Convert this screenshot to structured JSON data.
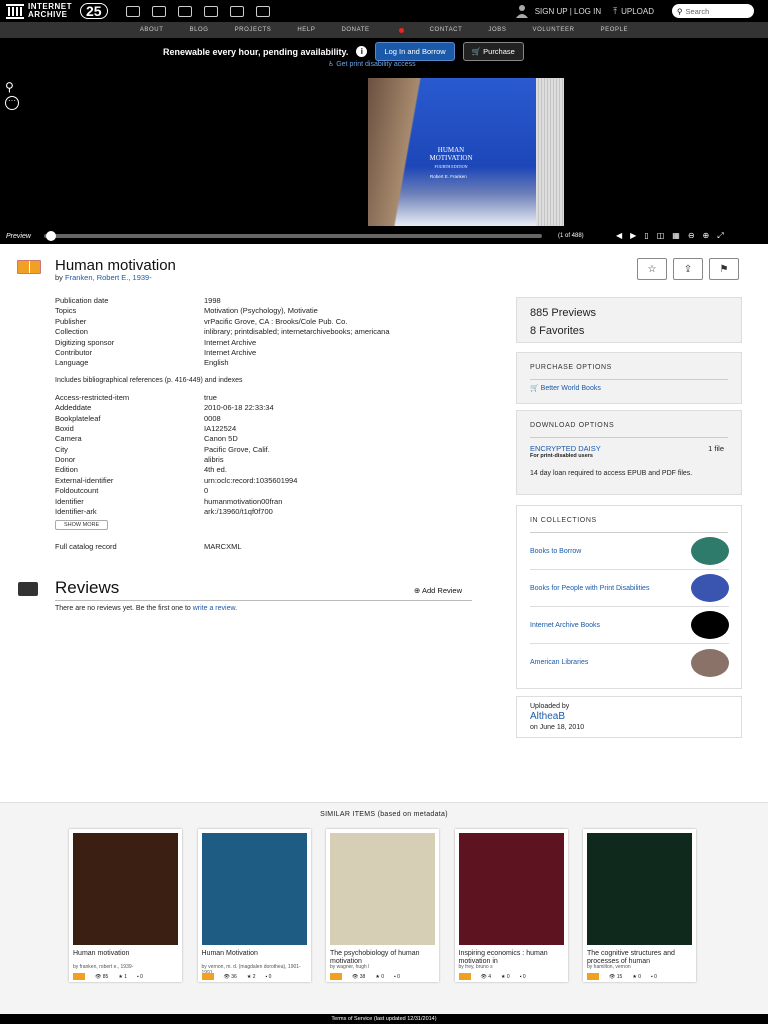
{
  "header": {
    "logo_line1": "INTERNET",
    "logo_line2": "ARCHIVE",
    "anniversary": "25",
    "signup": "SIGN UP | LOG IN",
    "upload": "UPLOAD",
    "search_placeholder": "Search"
  },
  "nav": [
    "ABOUT",
    "BLOG",
    "PROJECTS",
    "HELP",
    "DONATE",
    "CONTACT",
    "JOBS",
    "VOLUNTEER",
    "PEOPLE"
  ],
  "banner": {
    "message": "Renewable every hour, pending availability.",
    "borrow": "Log In and Borrow",
    "purchase": "Purchase",
    "print_link": "Get print disability access"
  },
  "viewer": {
    "mode_label": "Preview",
    "page_count": "(1 of 488)",
    "cover_title": "HUMAN MOTIVATION",
    "cover_edition": "FOURTH EDITION",
    "cover_author": "Robert E. Franken"
  },
  "item": {
    "title": "Human motivation",
    "by": "by",
    "author": "Franken, Robert E., 1939-"
  },
  "meta_top": [
    {
      "k": "Publication date",
      "v": "1998",
      "link": true
    },
    {
      "k": "Topics",
      "v": "Motivation (Psychology), Motivatie",
      "link": true
    },
    {
      "k": "Publisher",
      "v": "vrPacific Grove, CA : Brooks/Cole Pub. Co.",
      "link": false
    },
    {
      "k": "Collection",
      "v": "inlibrary; printdisabled; internetarchivebooks; americana",
      "link": true
    },
    {
      "k": "Digitizing sponsor",
      "v": "Internet Archive",
      "link": true
    },
    {
      "k": "Contributor",
      "v": "Internet Archive",
      "link": true
    },
    {
      "k": "Language",
      "v": "English",
      "link": true
    }
  ],
  "note": "Includes bibliographical references (p. 416-449) and indexes",
  "meta_bottom": [
    {
      "k": "Access-restricted-item",
      "v": "true",
      "link": false
    },
    {
      "k": "Addeddate",
      "v": "2010-06-18 22:33:34",
      "link": false
    },
    {
      "k": "Bookplateleaf",
      "v": "0008",
      "link": false
    },
    {
      "k": "Boxid",
      "v": "IA122524",
      "link": false
    },
    {
      "k": "Camera",
      "v": "Canon 5D",
      "link": false
    },
    {
      "k": "City",
      "v": "Pacific Grove, Calif.",
      "link": false
    },
    {
      "k": "Donor",
      "v": "alibris",
      "link": true
    },
    {
      "k": "Edition",
      "v": "4th ed.",
      "link": false
    },
    {
      "k": "External-identifier",
      "v": "urn:oclc:record:1035601994",
      "link": true
    },
    {
      "k": "Foldoutcount",
      "v": "0",
      "link": false
    },
    {
      "k": "Identifier",
      "v": "humanmotivation00fran",
      "link": false
    },
    {
      "k": "Identifier-ark",
      "v": "ark:/13960/t1qf0f700",
      "link": false
    }
  ],
  "show_more": "SHOW MORE",
  "catalog": {
    "k": "Full catalog record",
    "v": "MARCXML"
  },
  "reviews": {
    "title": "Reviews",
    "add": "Add Review",
    "none_text": "There are no reviews yet. Be the first one to",
    "none_link": "write a review",
    "none_end": "."
  },
  "stats": {
    "previews": "885 Previews",
    "favorites": "8 Favorites"
  },
  "purchase": {
    "heading": "PURCHASE OPTIONS",
    "bw": "Better World Books"
  },
  "download": {
    "heading": "DOWNLOAD OPTIONS",
    "daisy": "ENCRYPTED DAISY",
    "files": "1 file",
    "sub": "For print-disabled users",
    "loan": "14 day loan required to access EPUB and PDF files."
  },
  "collections": {
    "heading": "IN COLLECTIONS",
    "items": [
      {
        "name": "Books to Borrow",
        "color": "#2e7a6b"
      },
      {
        "name": "Books for People with Print Disabilities",
        "color": "#3a55b0"
      },
      {
        "name": "Internet Archive Books",
        "color": "#000000"
      },
      {
        "name": "American Libraries",
        "color": "#8a7268"
      }
    ]
  },
  "uploaded": {
    "label": "Uploaded by",
    "who": "AltheaB",
    "date": "on June 18, 2010"
  },
  "similar": {
    "heading": "SIMILAR ITEMS (based on metadata)",
    "items": [
      {
        "title": "Human motivation",
        "author": "by franken, robert e., 1939-",
        "views": "85",
        "favs": "1",
        "reviews": "0",
        "bg": "#3a1f12"
      },
      {
        "title": "Human Motivation",
        "author": "by vernon, m. d. (magdalen dorothea), 1901-1991",
        "views": "36",
        "favs": "2",
        "reviews": "0",
        "bg": "#1e5c83"
      },
      {
        "title": "The psychobiology of human motivation",
        "author": "by wagner, hugh l",
        "views": "38",
        "favs": "0",
        "reviews": "0",
        "bg": "#d7cfb5"
      },
      {
        "title": "Inspiring economics : human motivation in",
        "author": "by frey, bruno s",
        "views": "4",
        "favs": "0",
        "reviews": "0",
        "bg": "#5e1420"
      },
      {
        "title": "The cognitive structures and processes of human",
        "author": "by hamilton, vernon",
        "views": "15",
        "favs": "0",
        "reviews": "0",
        "bg": "#0f2a1c"
      }
    ]
  },
  "footer": "Terms of Service (last updated 12/31/2014)"
}
